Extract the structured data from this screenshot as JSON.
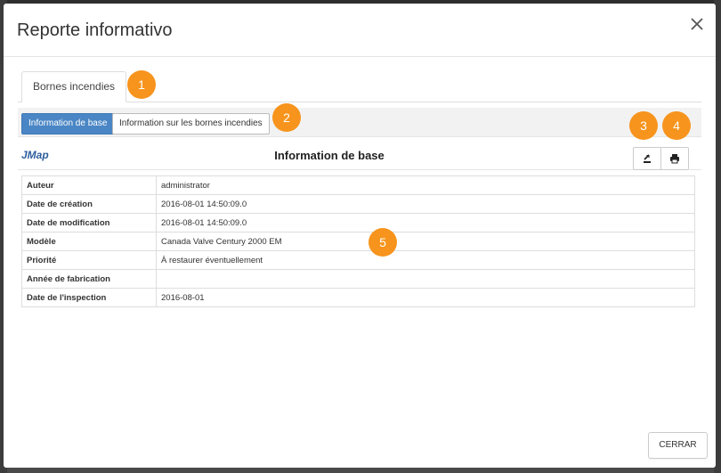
{
  "modal": {
    "title": "Reporte informativo",
    "close_label": "×",
    "footer_button": "CERRAR"
  },
  "tabs": [
    {
      "label": "Bornes incendies",
      "active": true
    }
  ],
  "subtabs": [
    {
      "label": "Information de base",
      "active": true
    },
    {
      "label": "Information sur les bornes incendies",
      "active": false
    }
  ],
  "report": {
    "logo_text": "JMap",
    "title": "Information de base",
    "export_icon": "export-icon",
    "print_icon": "print-icon"
  },
  "rows": [
    {
      "label": "Auteur",
      "value": "administrator"
    },
    {
      "label": "Date de création",
      "value": "2016-08-01 14:50:09.0"
    },
    {
      "label": "Date de modification",
      "value": "2016-08-01 14:50:09.0"
    },
    {
      "label": "Modèle",
      "value": "Canada Valve Century 2000 EM"
    },
    {
      "label": "Priorité",
      "value": "À restaurer éventuellement"
    },
    {
      "label": "Année de fabrication",
      "value": ""
    },
    {
      "label": "Date de l'inspection",
      "value": "2016-08-01"
    }
  ],
  "callouts": [
    "1",
    "2",
    "3",
    "4",
    "5"
  ],
  "colors": {
    "accent": "#4a86c5",
    "badge": "#f7941d",
    "logo": "#2e5e9e"
  }
}
